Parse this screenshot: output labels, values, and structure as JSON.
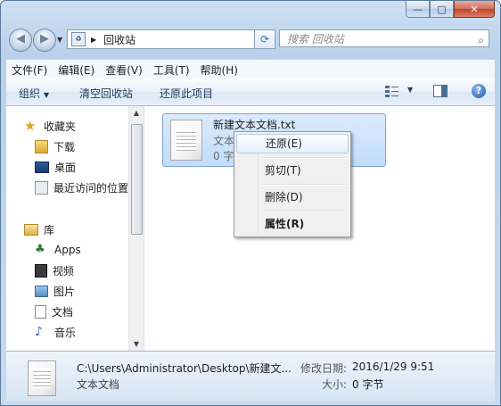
{
  "window": {
    "close_glyph": "✕",
    "max_glyph": "▢",
    "min_glyph": "—"
  },
  "nav": {
    "back_glyph": "◀",
    "forward_glyph": "▶",
    "address_text": "回收站",
    "refresh_glyph": "⟳",
    "search_placeholder": "搜索 回收站",
    "search_glyph": "⌕"
  },
  "menubar": {
    "items": [
      "文件(F)",
      "编辑(E)",
      "查看(V)",
      "工具(T)",
      "帮助(H)"
    ]
  },
  "commandbar": {
    "organize": "组织",
    "empty_bin": "清空回收站",
    "restore_all": "还原此项目"
  },
  "sidebar": {
    "favorites": "收藏夹",
    "favorites_items": [
      "下载",
      "桌面",
      "最近访问的位置"
    ],
    "libraries": "库",
    "library_items": [
      "Apps",
      "视频",
      "图片",
      "文档",
      "音乐"
    ]
  },
  "file": {
    "name": "新建文本文档.txt",
    "type": "文本文档",
    "size": "0 字节"
  },
  "context_menu": {
    "items": [
      "还原(E)",
      "剪切(T)",
      "删除(D)",
      "属性(R)"
    ]
  },
  "details": {
    "path": "C:\\Users\\Administrator\\Desktop\\新建文...",
    "type": "文本文档",
    "modified_label": "修改日期:",
    "modified_value": "2016/1/29 9:51",
    "size_label": "大小:",
    "size_value": "0 字节"
  },
  "colors": {
    "window_frame": "#b9d1ea",
    "selection": "#c1dcfc",
    "accent": "#1a5aa8"
  }
}
